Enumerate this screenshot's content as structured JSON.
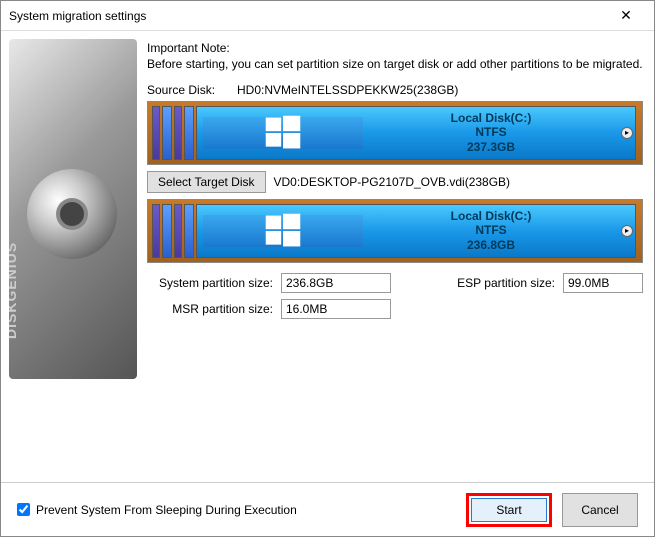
{
  "window": {
    "title": "System migration settings"
  },
  "brand": "DISKGENIUS",
  "note": {
    "title": "Important Note:",
    "body": "Before starting, you can set partition size on target disk or add other partitions to be migrated."
  },
  "source": {
    "label": "Source Disk:",
    "value": "HD0:NVMeINTELSSDPEKKW25(238GB)",
    "partition": {
      "name": "Local Disk(C:)",
      "fs": "NTFS",
      "size": "237.3GB"
    }
  },
  "target": {
    "button": "Select Target Disk",
    "value": "VD0:DESKTOP-PG2107D_OVB.vdi(238GB)",
    "partition": {
      "name": "Local Disk(C:)",
      "fs": "NTFS",
      "size": "236.8GB"
    }
  },
  "sizes": {
    "system_label": "System partition size:",
    "system_value": "236.8GB",
    "esp_label": "ESP partition size:",
    "esp_value": "99.0MB",
    "msr_label": "MSR partition size:",
    "msr_value": "16.0MB"
  },
  "footer": {
    "checkbox_label": "Prevent System From Sleeping During Execution",
    "start": "Start",
    "cancel": "Cancel"
  }
}
